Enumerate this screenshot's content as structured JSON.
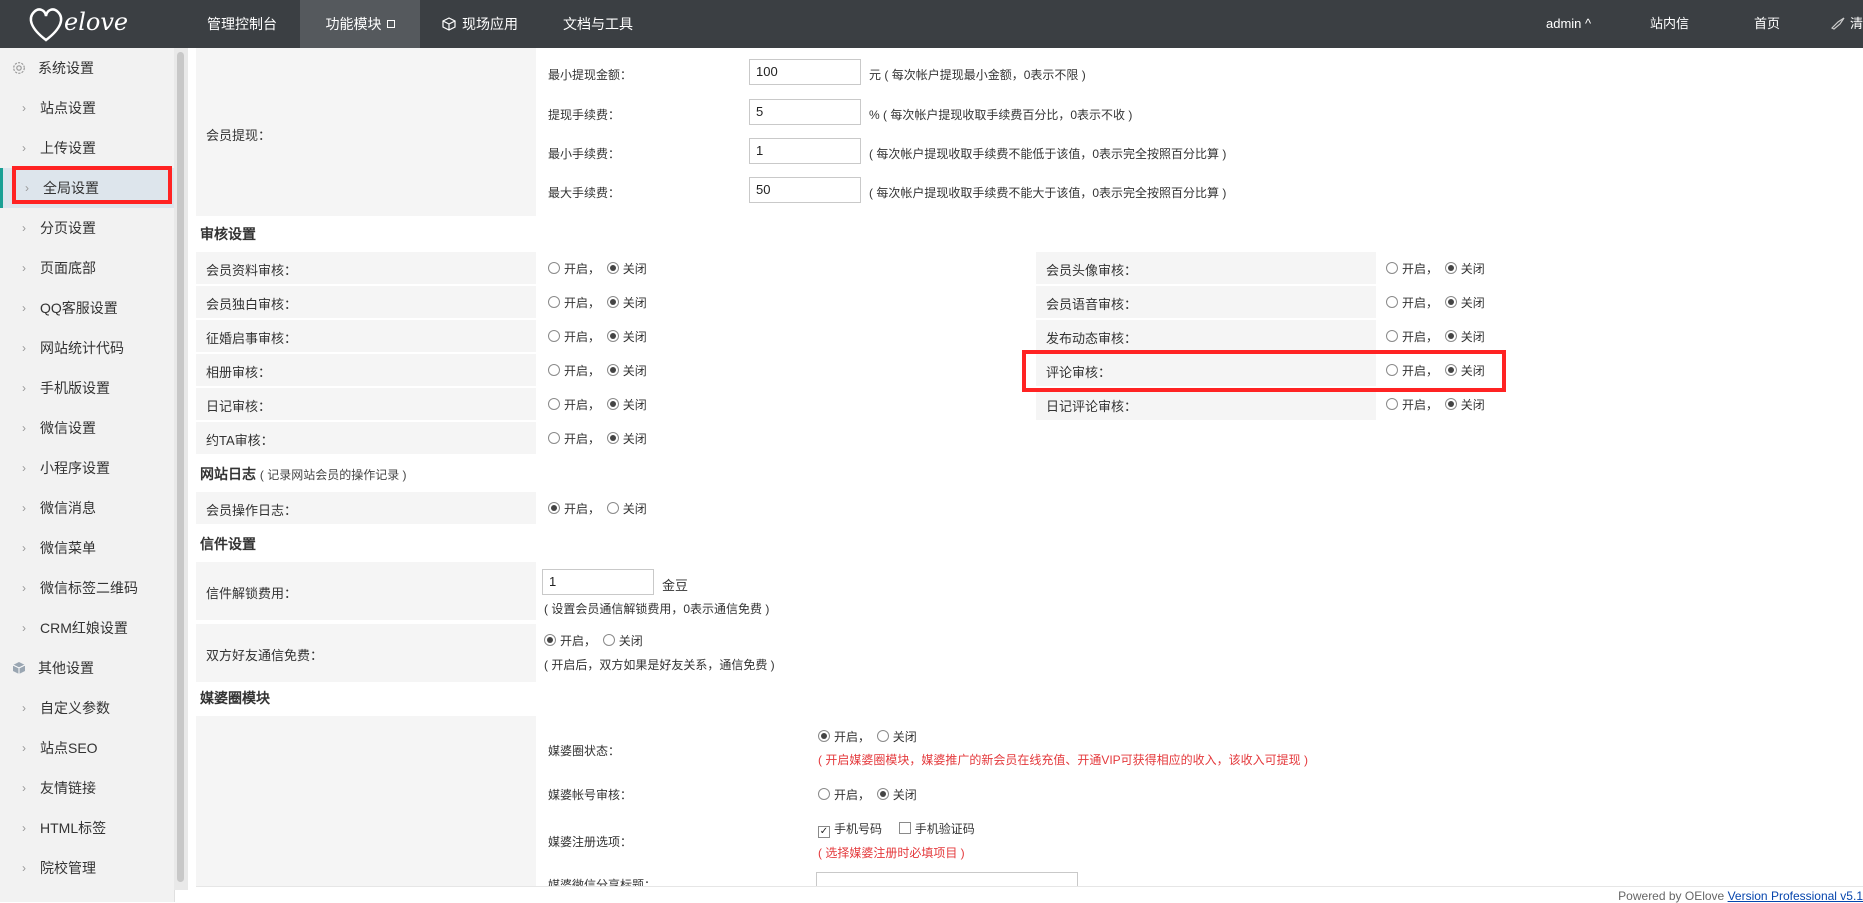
{
  "topbar": {
    "logo_text": "elove",
    "nav": [
      "管理控制台",
      "功能模块",
      "现场应用",
      "文档与工具"
    ],
    "user": "admin ^",
    "links": [
      "站内信",
      "首页",
      "清"
    ]
  },
  "sidebar": {
    "group1": "系统设置",
    "group1_items": [
      "站点设置",
      "上传设置",
      "全局设置",
      "分页设置",
      "页面底部",
      "QQ客服设置",
      "网站统计代码",
      "手机版设置",
      "微信设置",
      "小程序设置",
      "微信消息",
      "微信菜单",
      "微信标签二维码",
      "CRM红娘设置"
    ],
    "group2": "其他设置",
    "group2_items": [
      "自定义参数",
      "站点SEO",
      "友情链接",
      "HTML标签",
      "院校管理"
    ],
    "active": "全局设置"
  },
  "withdraw": {
    "label": "会员提现：",
    "rows": [
      {
        "label": "最小提现金额：",
        "value": "100",
        "unit": "元",
        "hint": "( 每次帐户提现最小金额，0表示不限 )"
      },
      {
        "label": "提现手续费：",
        "value": "5",
        "unit": "%",
        "hint": "( 每次帐户提现收取手续费百分比，0表示不收 )"
      },
      {
        "label": "最小手续费：",
        "value": "1",
        "unit": "",
        "hint": "( 每次帐户提现收取手续费不能低于该值，0表示完全按照百分比算 )"
      },
      {
        "label": "最大手续费：",
        "value": "50",
        "unit": "",
        "hint": "( 每次帐户提现收取手续费不能大于该值，0表示完全按照百分比算 )"
      }
    ]
  },
  "radio_labels": {
    "on": "开启，",
    "off": "关闭"
  },
  "audit": {
    "title": "审核设置",
    "left": [
      {
        "label": "会员资料审核：",
        "value": "off"
      },
      {
        "label": "会员独白审核：",
        "value": "off"
      },
      {
        "label": "征婚启事审核：",
        "value": "off"
      },
      {
        "label": "相册审核：",
        "value": "off"
      },
      {
        "label": "日记审核：",
        "value": "off"
      },
      {
        "label": "约TA审核：",
        "value": "off"
      }
    ],
    "right": [
      {
        "label": "会员头像审核：",
        "value": "off"
      },
      {
        "label": "会员语音审核：",
        "value": "off"
      },
      {
        "label": "发布动态审核：",
        "value": "off"
      },
      {
        "label": "评论审核：",
        "value": "off"
      },
      {
        "label": "日记评论审核：",
        "value": "off"
      }
    ]
  },
  "log": {
    "title": "网站日志",
    "subtitle": "( 记录网站会员的操作记录 )",
    "label": "会员操作日志：",
    "value": "on"
  },
  "letter": {
    "title": "信件设置",
    "unlock_label": "信件解锁费用：",
    "unlock_value": "1",
    "unlock_unit": "金豆",
    "unlock_hint": "( 设置会员通信解锁费用，0表示通信免费 )",
    "free_label": "双方好友通信免费：",
    "free_value": "on",
    "free_hint": "( 开启后，双方如果是好友关系，通信免费 )"
  },
  "matchmaker": {
    "title": "媒婆圈模块",
    "status_label": "媒婆圈状态：",
    "status_value": "on",
    "status_hint": "( 开启媒婆圈模块，媒婆推广的新会员在线充值、开通VIP可获得相应的收入，该收入可提现 )",
    "account_label": "媒婆帐号审核：",
    "account_value": "off",
    "reg_label": "媒婆注册选项：",
    "reg_opt1": "手机号码",
    "reg_opt2": "手机验证码",
    "reg_hint": "( 选择媒婆注册时必填项目 )",
    "share_label": "媒婆微信分享标题："
  },
  "footer": {
    "text": "Powered by OElove",
    "link": "Version Professional v5.1"
  },
  "colors": {
    "topbar": "#3b3f43",
    "highlight": "#ff2323",
    "active_bar": "#1aa094"
  }
}
